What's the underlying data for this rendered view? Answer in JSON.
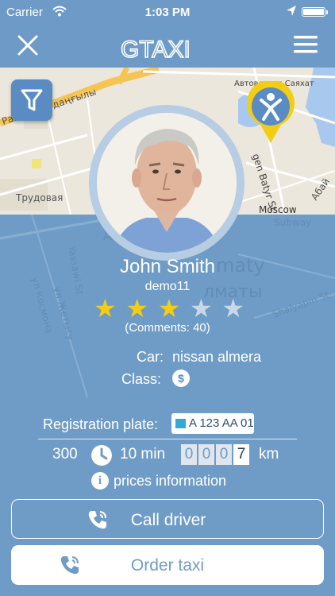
{
  "status_bar": {
    "carrier": "Carrier",
    "time": "1:03 PM"
  },
  "app": {
    "logo_text": "GTAXI"
  },
  "map": {
    "labels": {
      "street_1": "Райымбек даңғылы",
      "street_2": "Трудовая",
      "district": "АУДАНЫ",
      "street_3": "Yassawi St",
      "street_4": "ул Жетысу",
      "street_5": "ул Космона",
      "place_1": "Автовокзал Саяхат",
      "street_6": "gen Batyr St",
      "street_7": "Абай",
      "city_1": "maty",
      "city_2": "лматы",
      "street_8": "Shalyapin St",
      "poi": "Moscow",
      "poi_sub": "Subway"
    }
  },
  "driver": {
    "name": "John Smith",
    "login": "demo11",
    "rating": 3,
    "rating_max": 5,
    "comments": "(Comments: 40)",
    "car_label": "Car:",
    "car": "nissan almera",
    "class_label": "Class:",
    "class_icon": "$"
  },
  "registration": {
    "label": "Registration plate:",
    "plate": "A 123 AA 01"
  },
  "trip": {
    "distance": "300",
    "minutes": "10 min",
    "odometer": [
      "0",
      "0",
      "0",
      "7"
    ],
    "unit": "km"
  },
  "prices": {
    "info_text": "prices information"
  },
  "buttons": {
    "call": "Call driver",
    "order": "Order taxi"
  },
  "colors": {
    "background": "#6f9cc6",
    "navbar": "#6d9ac6",
    "star_filled": "#f3cd15",
    "star_empty": "#c9d8e8",
    "pin": "#f3cd15"
  }
}
